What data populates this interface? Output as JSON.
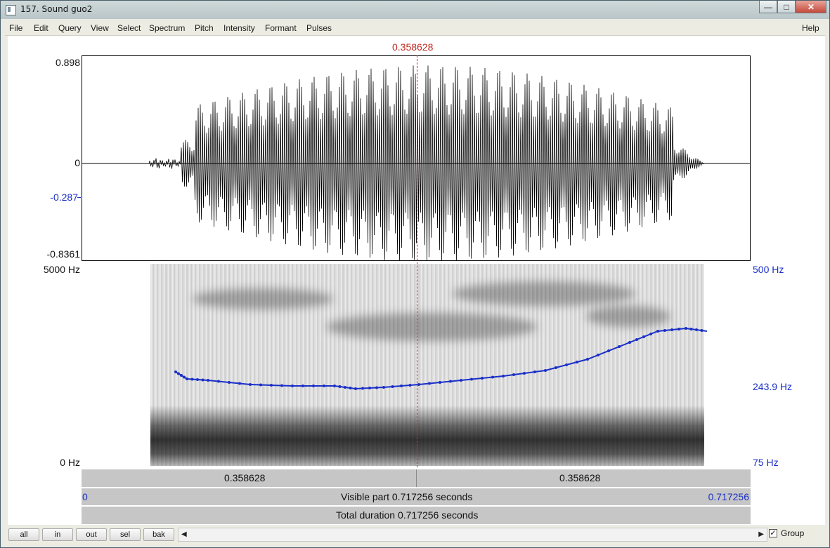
{
  "window": {
    "title": "157. Sound guo2"
  },
  "titlebar_buttons": [
    "minimize",
    "maximize",
    "close"
  ],
  "menu": [
    "File",
    "Edit",
    "Query",
    "View",
    "Select",
    "Spectrum",
    "Pitch",
    "Intensity",
    "Formant",
    "Pulses"
  ],
  "help": "Help",
  "cursor": {
    "time": "0.358628"
  },
  "waveform": {
    "y_max": "0.898",
    "y_zero": "0",
    "y_cursor": "-0.287",
    "y_min": "-0.8361"
  },
  "spectrogram": {
    "freq_max": "5000 Hz",
    "freq_min": "0 Hz",
    "pitch_max": "500 Hz",
    "pitch_cursor": "243.9 Hz",
    "pitch_min": "75 Hz"
  },
  "time_bar": {
    "left": "0.358628",
    "right": "0.358628"
  },
  "visible_bar": {
    "start": "0",
    "label": "Visible part 0.717256 seconds",
    "end": "0.717256"
  },
  "total_bar": {
    "label": "Total duration 0.717256 seconds"
  },
  "zoom_buttons": [
    "all",
    "in",
    "out",
    "sel",
    "bak"
  ],
  "group": {
    "label": "Group",
    "checked": true
  },
  "colors": {
    "cursor": "#c0281f",
    "pitch": "#1a2fc8",
    "axis_blue": "#1a2fc8"
  }
}
